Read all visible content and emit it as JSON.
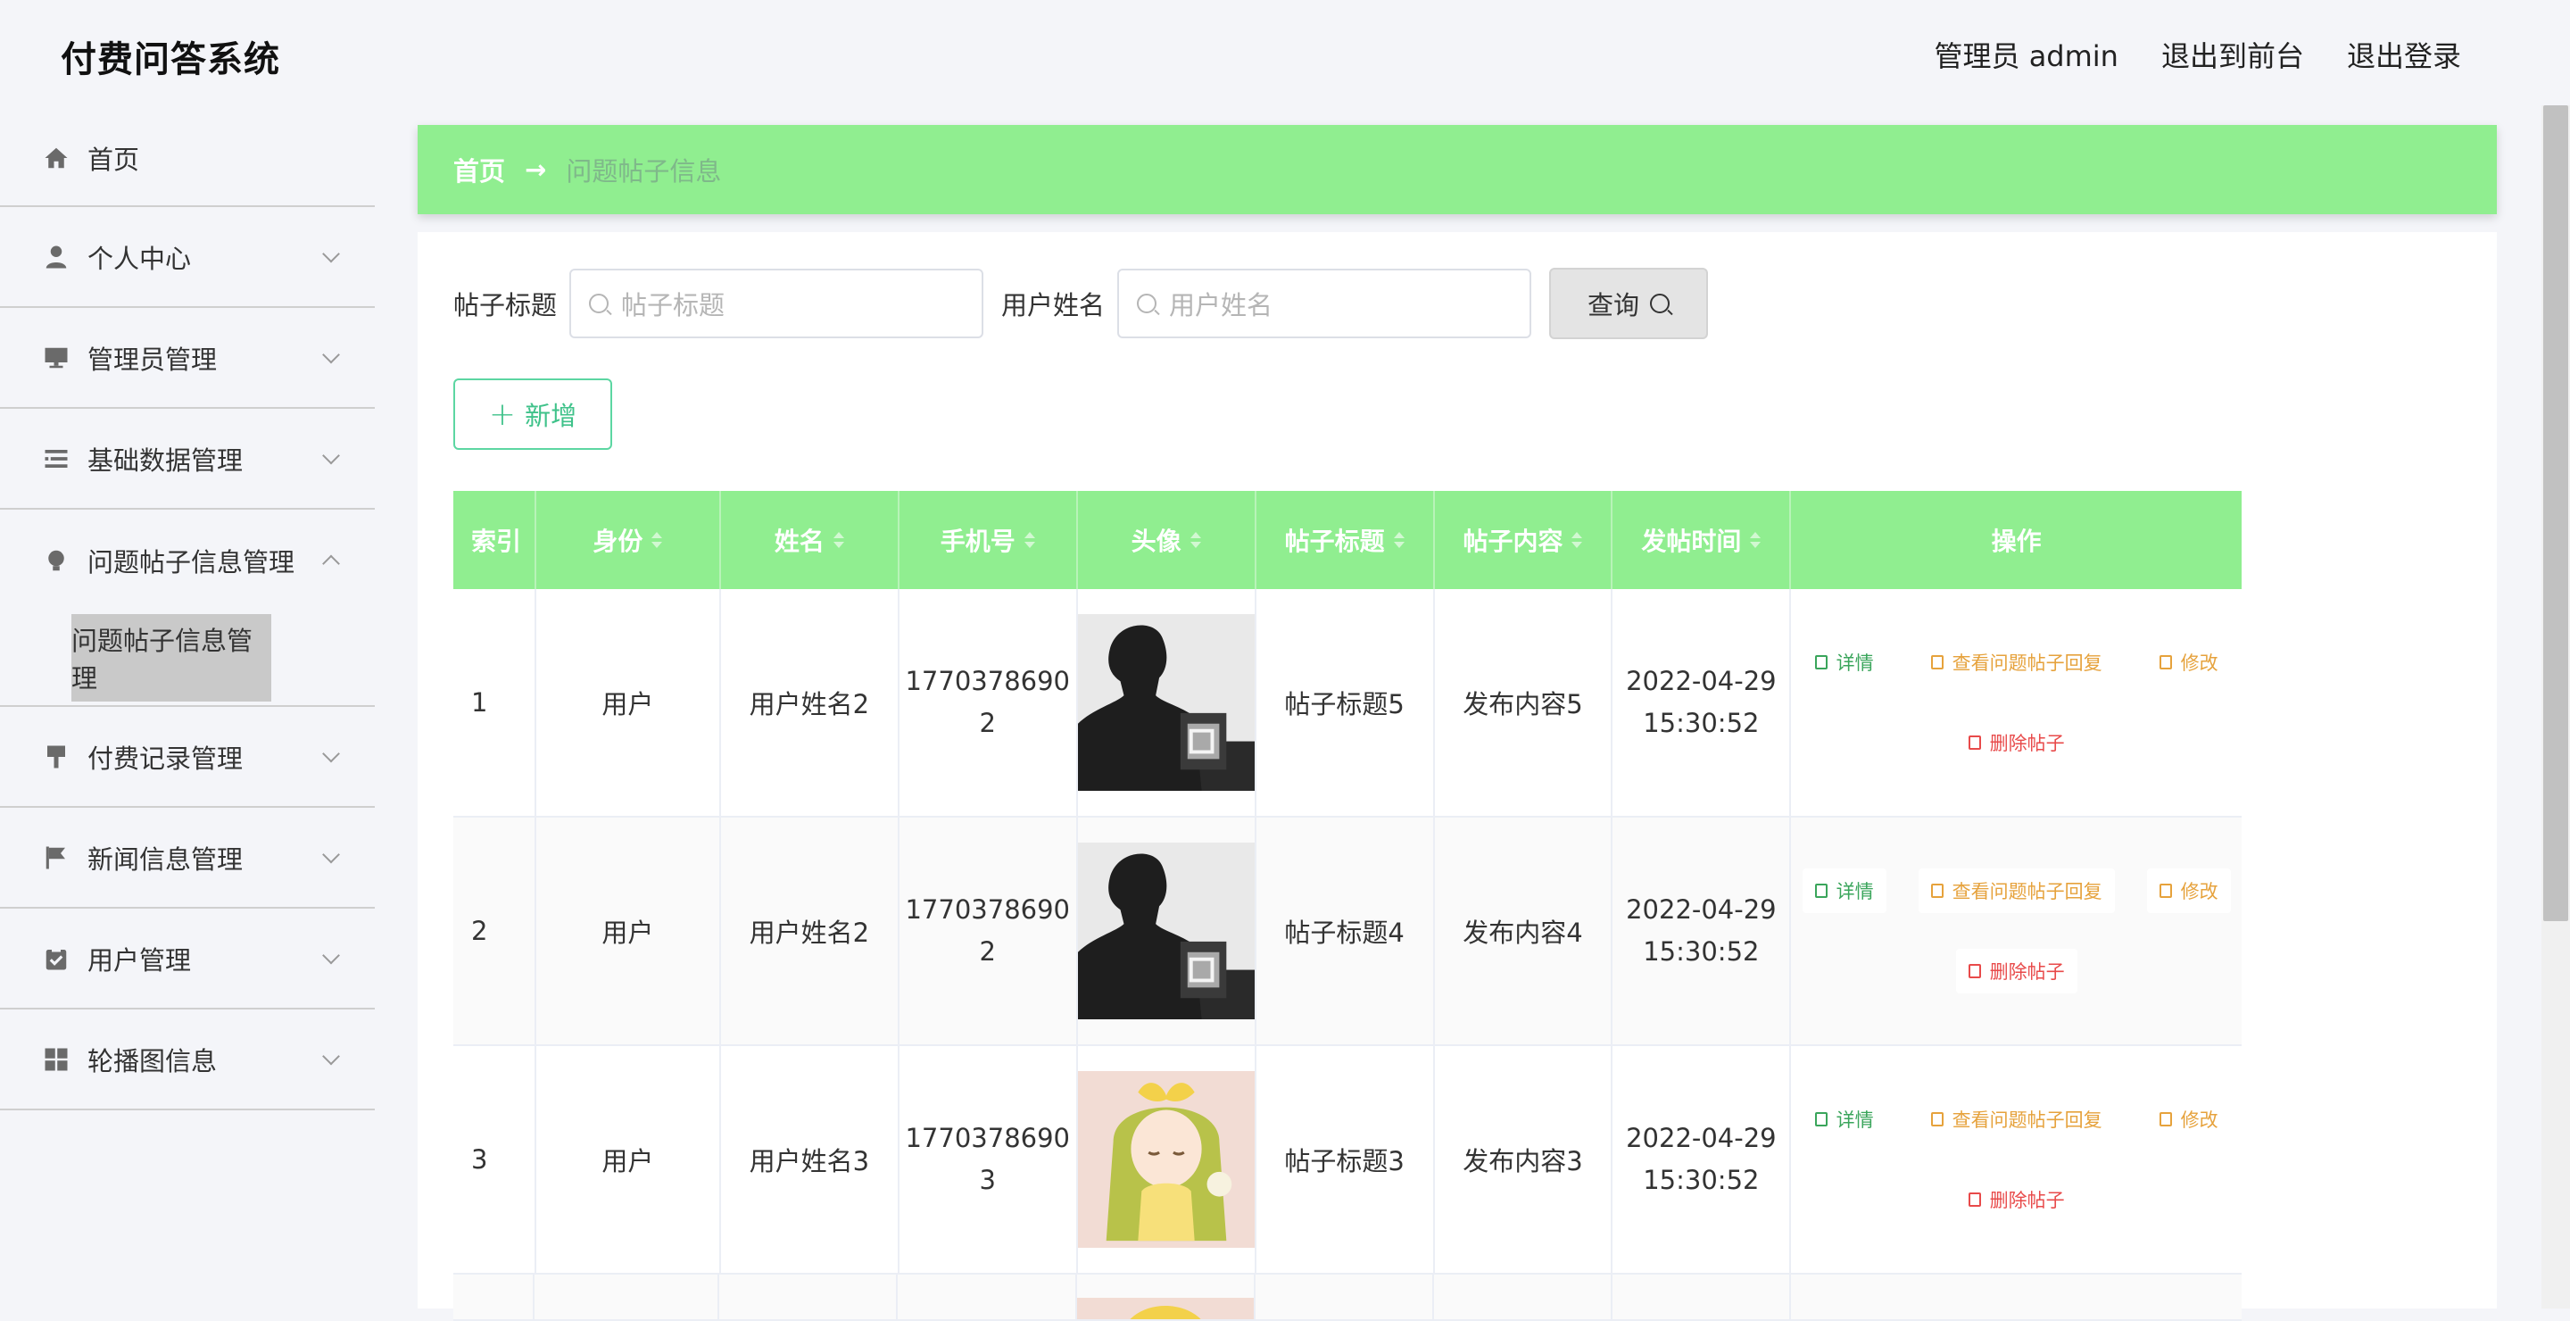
{
  "header": {
    "app_title": "付费问答系统",
    "admin_label": "管理员 admin",
    "to_front_label": "退出到前台",
    "logout_label": "退出登录"
  },
  "sidebar": {
    "items": [
      {
        "label": "首页",
        "icon": "home-icon"
      },
      {
        "label": "个人中心",
        "icon": "user-icon"
      },
      {
        "label": "管理员管理",
        "icon": "monitor-icon"
      },
      {
        "label": "基础数据管理",
        "icon": "list-icon"
      },
      {
        "label": "问题帖子信息管理",
        "icon": "bulb-icon",
        "expanded": true
      },
      {
        "label": "付费记录管理",
        "icon": "brush-icon"
      },
      {
        "label": "新闻信息管理",
        "icon": "flag-icon"
      },
      {
        "label": "用户管理",
        "icon": "clipboard-icon"
      },
      {
        "label": "轮播图信息",
        "icon": "grid-icon"
      }
    ],
    "sub_item": "问题帖子信息管理"
  },
  "breadcrumb": {
    "home": "首页",
    "arrow": "→",
    "current": "问题帖子信息"
  },
  "search": {
    "title_label": "帖子标题",
    "title_placeholder": "帖子标题",
    "username_label": "用户姓名",
    "username_placeholder": "用户姓名",
    "query_label": "查询"
  },
  "add_button": {
    "label": "新增"
  },
  "table": {
    "headers": [
      "索引",
      "身份",
      "姓名",
      "手机号",
      "头像",
      "帖子标题",
      "帖子内容",
      "发帖时间",
      "操作"
    ],
    "rows": [
      {
        "index": "1",
        "identity": "用户",
        "name": "用户姓名2",
        "phone_a": "1770378690",
        "phone_b": "2",
        "avatar": "man-silhouette",
        "title": "帖子标题5",
        "content": "发布内容5",
        "date": "2022-04-29",
        "time": "15:30:52"
      },
      {
        "index": "2",
        "identity": "用户",
        "name": "用户姓名2",
        "phone_a": "1770378690",
        "phone_b": "2",
        "avatar": "man-silhouette",
        "title": "帖子标题4",
        "content": "发布内容4",
        "date": "2022-04-29",
        "time": "15:30:52"
      },
      {
        "index": "3",
        "identity": "用户",
        "name": "用户姓名3",
        "phone_a": "1770378690",
        "phone_b": "3",
        "avatar": "anime-girl",
        "title": "帖子标题3",
        "content": "发布内容3",
        "date": "2022-04-29",
        "time": "15:30:52"
      }
    ],
    "actions": {
      "detail": "详情",
      "view_reply": "查看问题帖子回复",
      "edit": "修改",
      "delete": "删除帖子"
    }
  },
  "colors": {
    "accent_green": "#90ee90",
    "detail": "#3aa55b",
    "warn": "#e6a23c",
    "danger": "#e84a4a"
  }
}
